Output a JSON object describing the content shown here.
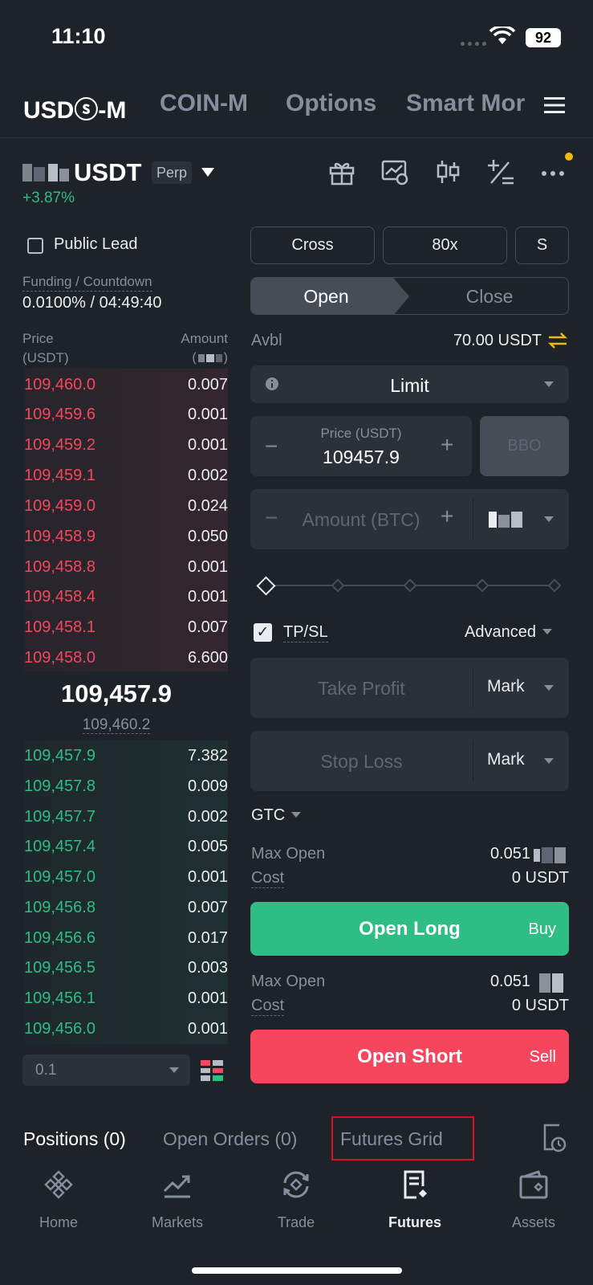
{
  "status_bar": {
    "time": "11:10",
    "battery": "92"
  },
  "top_tabs": [
    "USDⓢ-M",
    "COIN-M",
    "Options",
    "Smart Mor"
  ],
  "symbol": {
    "name": "USDT",
    "badge": "Perp",
    "change": "+3.87%"
  },
  "left_panel": {
    "public_lead": "Public Lead",
    "funding_label": "Funding / Countdown",
    "funding_value": "0.0100% / 04:49:40",
    "price_header_line1": "Price",
    "price_header_line2": "(USDT)",
    "amount_header": "Amount"
  },
  "order_book": {
    "asks": [
      {
        "price": "109,460.0",
        "amount": "0.007"
      },
      {
        "price": "109,459.6",
        "amount": "0.001"
      },
      {
        "price": "109,459.2",
        "amount": "0.001"
      },
      {
        "price": "109,459.1",
        "amount": "0.002"
      },
      {
        "price": "109,459.0",
        "amount": "0.024"
      },
      {
        "price": "109,458.9",
        "amount": "0.050"
      },
      {
        "price": "109,458.8",
        "amount": "0.001"
      },
      {
        "price": "109,458.4",
        "amount": "0.001"
      },
      {
        "price": "109,458.1",
        "amount": "0.007"
      },
      {
        "price": "109,458.0",
        "amount": "6.600"
      }
    ],
    "last_price": "109,457.9",
    "mark_price": "109,460.2",
    "bids": [
      {
        "price": "109,457.9",
        "amount": "7.382"
      },
      {
        "price": "109,457.8",
        "amount": "0.009"
      },
      {
        "price": "109,457.7",
        "amount": "0.002"
      },
      {
        "price": "109,457.4",
        "amount": "0.005"
      },
      {
        "price": "109,457.0",
        "amount": "0.001"
      },
      {
        "price": "109,456.8",
        "amount": "0.007"
      },
      {
        "price": "109,456.6",
        "amount": "0.017"
      },
      {
        "price": "109,456.5",
        "amount": "0.003"
      },
      {
        "price": "109,456.1",
        "amount": "0.001"
      },
      {
        "price": "109,456.0",
        "amount": "0.001"
      }
    ],
    "precision": "0.1"
  },
  "order_form": {
    "margin_mode": "Cross",
    "leverage": "80x",
    "asset_mode": "S",
    "open_tab": "Open",
    "close_tab": "Close",
    "avbl_label": "Avbl",
    "avbl_value": "70.00 USDT",
    "order_type": "Limit",
    "price_label": "Price (USDT)",
    "price_value": "109457.9",
    "bbo": "BBO",
    "amount_placeholder": "Amount (BTC)",
    "tpsl_label": "TP/SL",
    "advanced": "Advanced",
    "take_profit": "Take Profit",
    "stop_loss": "Stop Loss",
    "trigger_type": "Mark",
    "time_in_force": "GTC",
    "long": {
      "max_open_label": "Max Open",
      "max_open_value": "0.051",
      "cost_label": "Cost",
      "cost_value": "0 USDT",
      "button": "Open Long",
      "side": "Buy"
    },
    "short": {
      "max_open_label": "Max Open",
      "max_open_value": "0.051",
      "cost_label": "Cost",
      "cost_value": "0 USDT",
      "button": "Open Short",
      "side": "Sell"
    }
  },
  "bottom_tabs": {
    "positions": "Positions (0)",
    "open_orders": "Open Orders (0)",
    "futures_grid": "Futures Grid"
  },
  "nav": [
    "Home",
    "Markets",
    "Trade",
    "Futures",
    "Assets"
  ],
  "colors": {
    "ask": "#f6465d",
    "bid": "#2ebd85",
    "accent": "#f0b90b",
    "background": "#1e2329"
  }
}
